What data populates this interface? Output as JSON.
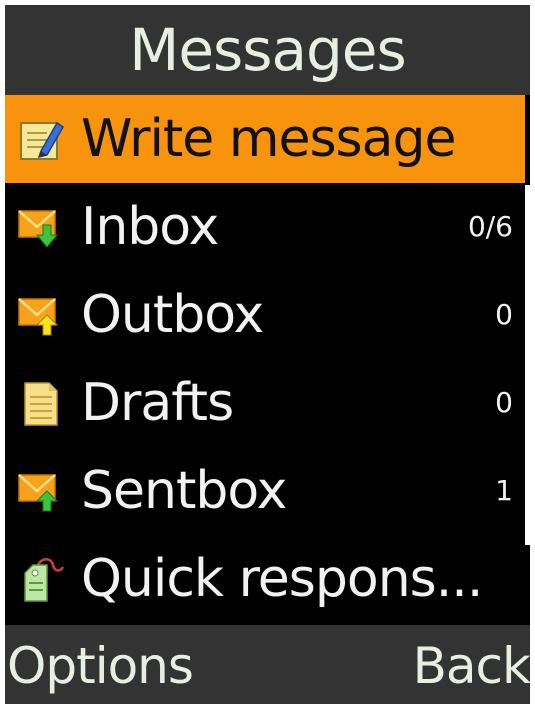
{
  "header": {
    "title": "Messages"
  },
  "menu": {
    "items": [
      {
        "label": "Write message",
        "count": "",
        "icon": "write-message-icon",
        "selected": true
      },
      {
        "label": "Inbox",
        "count": "0/6",
        "icon": "inbox-icon",
        "selected": false
      },
      {
        "label": "Outbox",
        "count": "0",
        "icon": "outbox-icon",
        "selected": false
      },
      {
        "label": "Drafts",
        "count": "0",
        "icon": "drafts-icon",
        "selected": false
      },
      {
        "label": "Sentbox",
        "count": "1",
        "icon": "sentbox-icon",
        "selected": false
      },
      {
        "label": "Quick respons...",
        "count": "",
        "icon": "quick-response-icon",
        "selected": false
      }
    ]
  },
  "softkeys": {
    "left": "Options",
    "right": "Back"
  },
  "colors": {
    "selection": "#f7930c",
    "bar_background": "#333333",
    "list_background": "#000000",
    "text": "#f2f2f2"
  }
}
